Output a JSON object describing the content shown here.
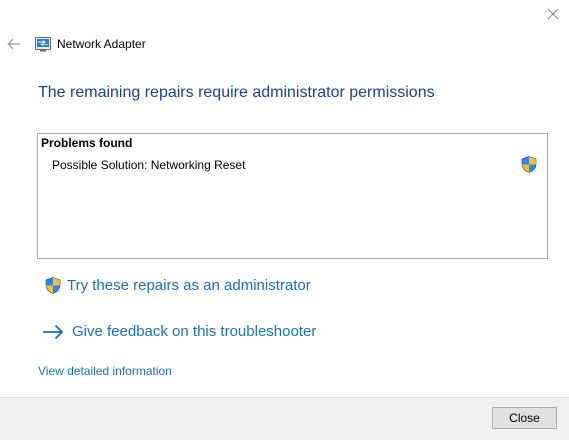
{
  "window": {
    "app_title": "Network Adapter",
    "close_icon": "close-icon",
    "back_icon": "back-arrow-icon",
    "app_icon": "network-adapter-icon"
  },
  "heading": "The remaining repairs require administrator permissions",
  "problems": {
    "title": "Problems found",
    "items": [
      {
        "label": "Possible Solution: Networking Reset",
        "icon": "uac-shield-icon"
      }
    ]
  },
  "actions": {
    "admin_repair": {
      "label": "Try these repairs as an administrator",
      "icon": "uac-shield-icon"
    },
    "feedback": {
      "label": "Give feedback on this troubleshooter",
      "icon": "arrow-right-icon"
    }
  },
  "details_link": "View detailed information",
  "footer": {
    "close_label": "Close"
  },
  "colors": {
    "heading": "#1d3f8c",
    "link": "#1a6fb8",
    "footer_bg": "#f0f0f0"
  }
}
